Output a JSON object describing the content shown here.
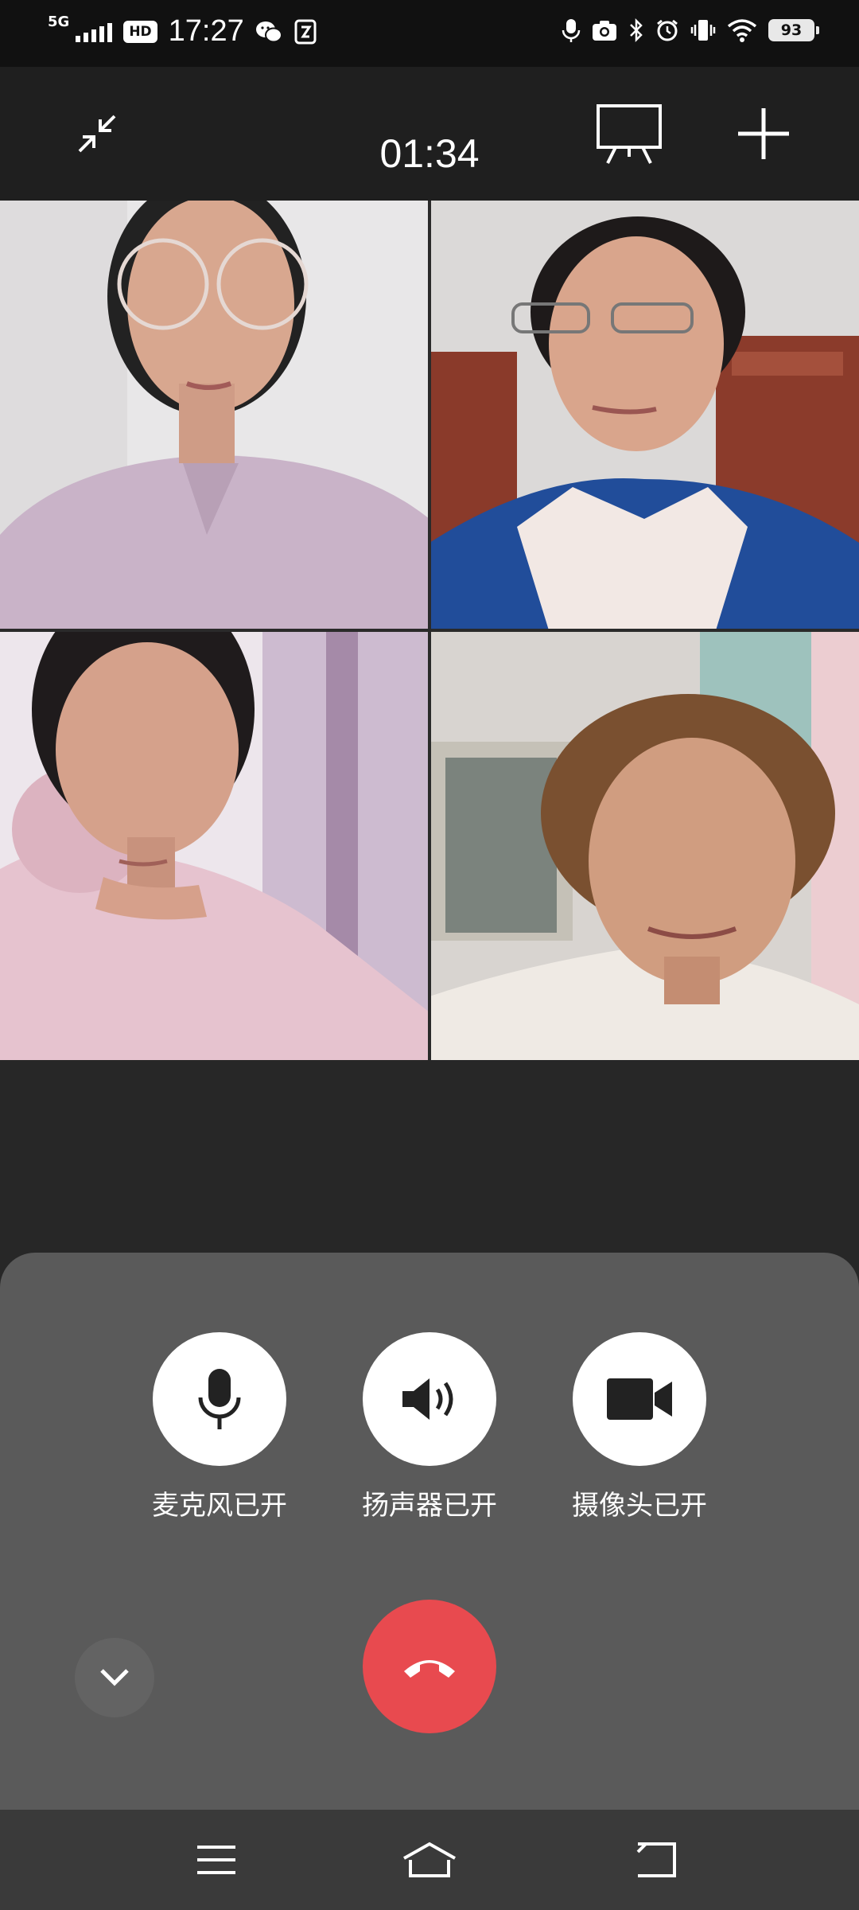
{
  "status_bar": {
    "network": "5G",
    "hd": "HD",
    "time": "17:27",
    "battery": "93"
  },
  "top_bar": {
    "timer": "01:34"
  },
  "participants": [
    {
      "shirt": "#c9b3c8",
      "bg": "#e7e6e7"
    },
    {
      "shirt": "#214d9a",
      "bg": "#d8d6d6"
    },
    {
      "shirt": "#e6c3cf",
      "bg": "#ddd5dc"
    },
    {
      "shirt": "#efeae4",
      "bg": "#cfc8c3"
    }
  ],
  "controls": {
    "mic_label": "麦克风已开",
    "speaker_label": "扬声器已开",
    "camera_label": "摄像头已开"
  },
  "colors": {
    "hangup": "#e84a4f",
    "panel": "#5a5a5a"
  }
}
